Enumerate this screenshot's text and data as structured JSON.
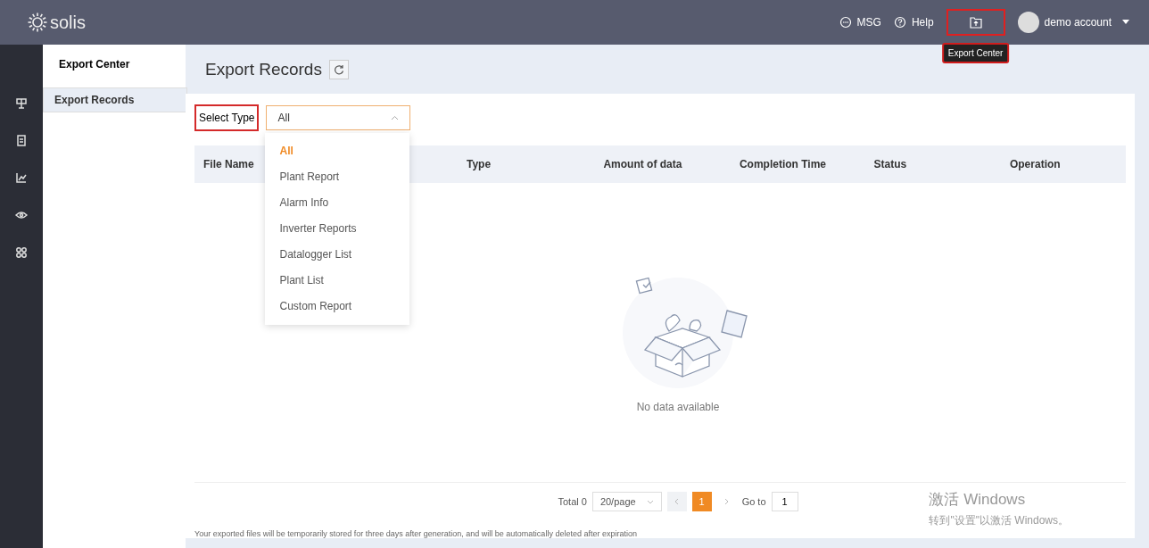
{
  "topbar": {
    "logo": "solis",
    "items": [
      {
        "kind": "msg",
        "label": "MSG"
      },
      {
        "kind": "help",
        "label": "Help"
      },
      {
        "kind": "export",
        "highlighted": true,
        "tooltip": "Export Center"
      }
    ],
    "account": "demo account"
  },
  "rail": [
    {
      "kind": "plant"
    },
    {
      "kind": "doc"
    },
    {
      "kind": "chart"
    },
    {
      "kind": "eye"
    },
    {
      "kind": "grid"
    }
  ],
  "submenu": {
    "title": "Export Center",
    "items": [
      {
        "label": "Export Records",
        "selected": true
      }
    ]
  },
  "page_title": "Export Records",
  "filter": {
    "label": "Select Type",
    "highlighted": true,
    "value": "All",
    "expanded": true,
    "options": [
      {
        "label": "All",
        "selected": true
      },
      {
        "label": "Plant Report",
        "selected": false
      },
      {
        "label": "Alarm Info",
        "selected": false
      },
      {
        "label": "Inverter Reports",
        "selected": false
      },
      {
        "label": "Datalogger List",
        "selected": false
      },
      {
        "label": "Plant List",
        "selected": false
      },
      {
        "label": "Custom Report",
        "selected": false
      }
    ]
  },
  "table": {
    "columns": [
      "File Name",
      "Type",
      "Amount of data",
      "Completion Time",
      "Status",
      "Operation"
    ],
    "empty_text": "No data available"
  },
  "pagination": {
    "total": "Total 0",
    "page_size": "20/page",
    "pages": [
      {
        "label": "1",
        "selected": true
      }
    ],
    "goto_label": "Go to",
    "goto_value": "1"
  },
  "note": "Your exported files will be temporarily stored for three days after generation, and will be automatically deleted after expiration",
  "os_overlay": {
    "title": "激活 Windows",
    "subtitle": "转到\"设置\"以激活 Windows。"
  }
}
